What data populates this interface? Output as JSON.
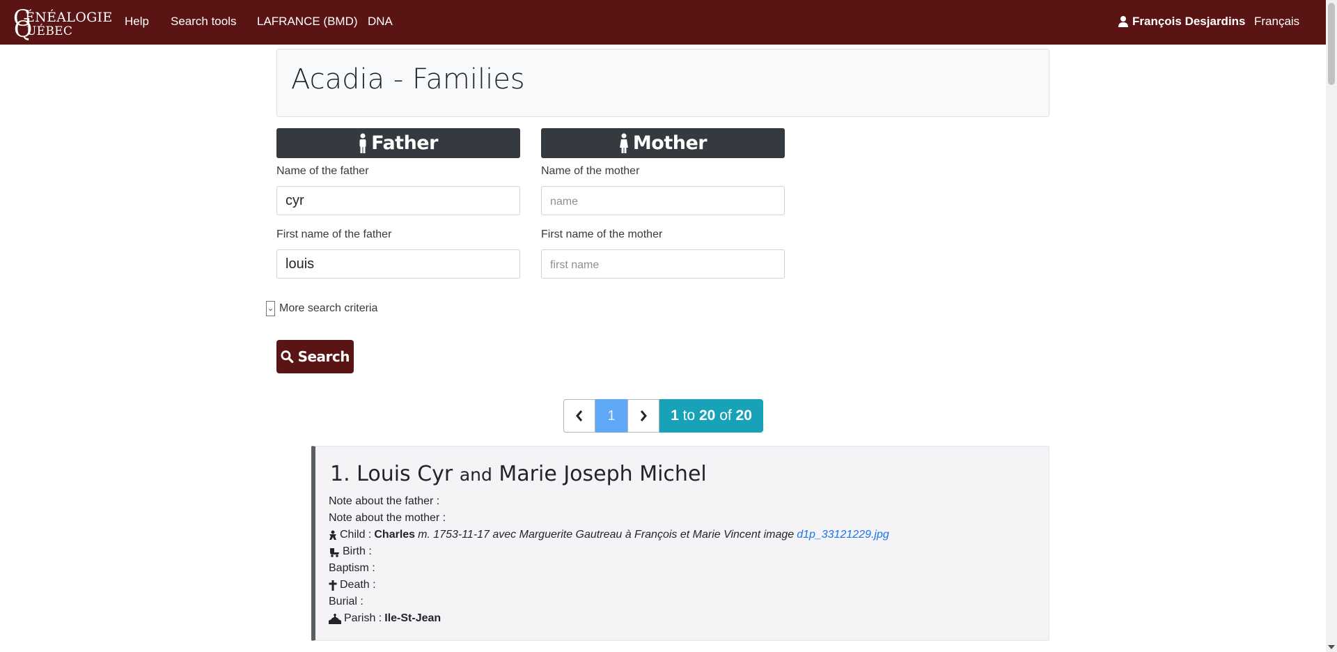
{
  "navbar": {
    "logo": {
      "g": "G",
      "line1": "ÉNÉALOGIE",
      "q": "Q",
      "line2": "UÉBEC"
    },
    "links": [
      "Help",
      "Search tools",
      "LAFRANCE (BMD)",
      "DNA"
    ],
    "user": "François Desjardins",
    "language": "Français"
  },
  "page": {
    "title": "Acadia - Families"
  },
  "father": {
    "header": "Father",
    "name_label": "Name of the father",
    "name_value": "cyr",
    "first_label": "First name of the father",
    "first_value": "louis"
  },
  "mother": {
    "header": "Mother",
    "name_label": "Name of the mother",
    "name_placeholder": "name",
    "first_label": "First name of the mother",
    "first_placeholder": "first name"
  },
  "more_criteria": "More search criteria",
  "search_button": "Search",
  "pagination": {
    "current": "1",
    "from": "1",
    "to_word": "to",
    "to": "20",
    "of_word": "of",
    "total": "20"
  },
  "result": {
    "num": "1.",
    "father": "Louis Cyr",
    "and": "and",
    "mother": "Marie Joseph Michel",
    "note_father": "Note about the father :",
    "note_mother": "Note about the mother :",
    "child_label": "Child :",
    "child_name": "Charles",
    "child_detail": "m. 1753-11-17 avec Marguerite Gautreau à François et Marie Vincent image",
    "child_image": "d1p_33121229.jpg",
    "birth": "Birth :",
    "baptism": "Baptism :",
    "death": "Death :",
    "burial": "Burial :",
    "parish_label": "Parish :",
    "parish_value": "Ile-St-Jean"
  },
  "colors": {
    "brand": "#5a1414",
    "dark": "#343a40",
    "info": "#17a2b8",
    "active": "#5fa8f5"
  }
}
